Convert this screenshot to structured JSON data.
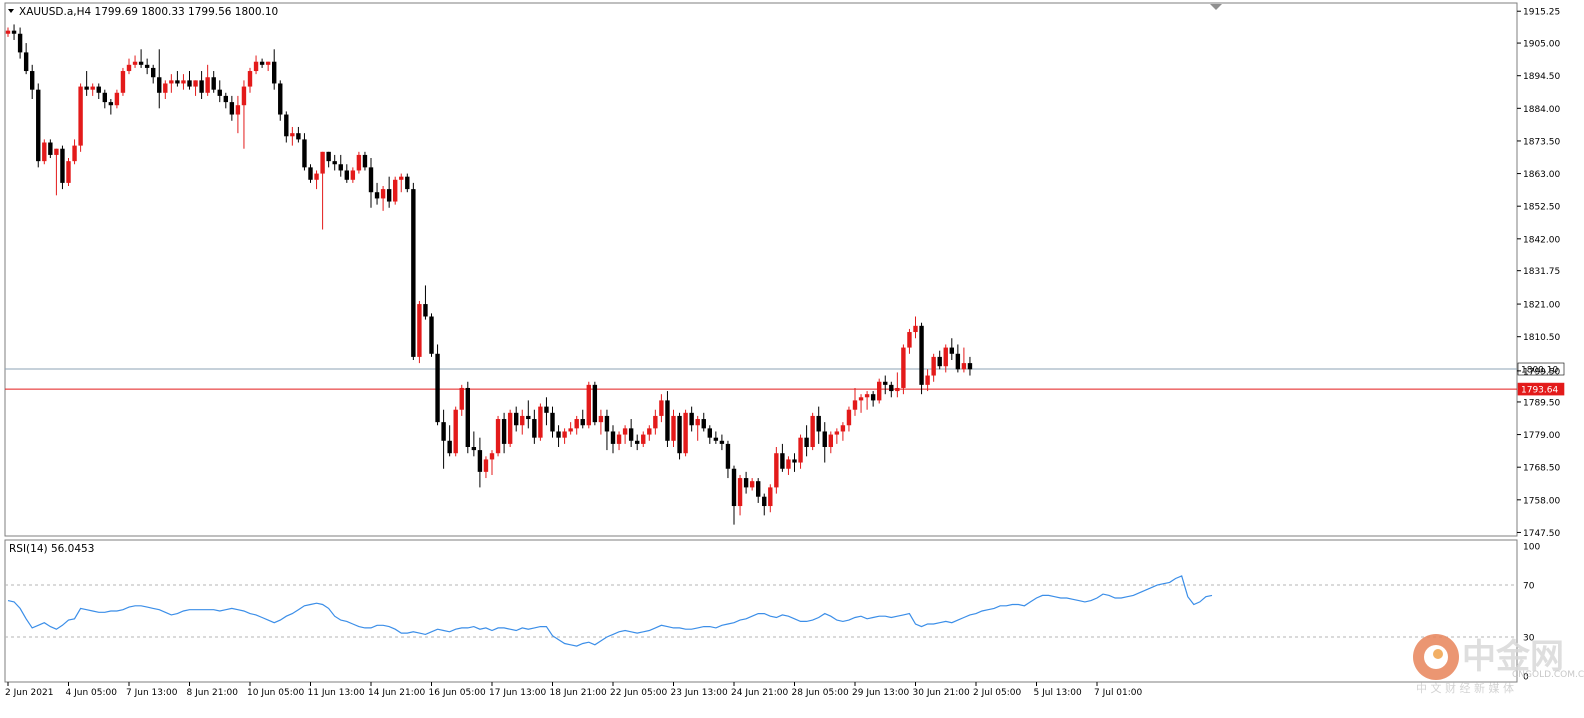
{
  "header": {
    "symbol_line": "XAUUSD.a,H4  1799.69 1800.33 1799.56 1800.10"
  },
  "rsi_panel": {
    "label": "RSI(14) 56.0453"
  },
  "watermark": {
    "brand": "中金网",
    "site": "CNGOLD.COM.CN",
    "tagline": "中 文 财 经 新 媒 体"
  },
  "chart_data": [
    {
      "type": "candlestick",
      "symbol": "XAUUSD.a",
      "timeframe": "H4",
      "ylim": [
        1747.0,
        1915.0
      ],
      "y_tick_labels": [
        "1915.25",
        "1905.00",
        "1894.50",
        "1884.00",
        "1873.50",
        "1863.00",
        "1852.50",
        "1842.00",
        "1831.75",
        "1821.00",
        "1810.50",
        "1799.50",
        "1789.50",
        "1779.00",
        "1768.50",
        "1758.00",
        "1747.50"
      ],
      "y_ticks": [
        1915.25,
        1905.0,
        1894.5,
        1884.0,
        1873.5,
        1863.0,
        1852.5,
        1842.0,
        1831.75,
        1821.0,
        1810.5,
        1799.5,
        1789.5,
        1779.0,
        1768.5,
        1758.0,
        1747.5
      ],
      "x_tick_labels": [
        "2 Jun 2021",
        "4 Jun 05:00",
        "7 Jun 13:00",
        "8 Jun 21:00",
        "10 Jun 05:00",
        "11 Jun 13:00",
        "14 Jun 21:00",
        "16 Jun 05:00",
        "17 Jun 13:00",
        "18 Jun 21:00",
        "22 Jun 05:00",
        "23 Jun 13:00",
        "24 Jun 21:00",
        "28 Jun 05:00",
        "29 Jun 13:00",
        "30 Jun 21:00",
        "2 Jul 05:00",
        "5 Jul 13:00",
        "7 Jul 01:00"
      ],
      "x_tick_index": [
        0,
        10,
        20,
        30,
        40,
        50,
        60,
        70,
        80,
        90,
        100,
        110,
        120,
        130,
        140,
        150,
        160,
        170,
        180
      ],
      "price_lines": [
        {
          "value": 1800.1,
          "label": "1800.10",
          "color": "#8ca3b5"
        },
        {
          "value": 1793.64,
          "label": "1793.64",
          "color": "#e31a1a"
        }
      ],
      "bull_color": "#e31a1a",
      "bear_color": "#000000",
      "ohlc": [
        [
          1908,
          1910,
          1907,
          1909
        ],
        [
          1909,
          1911,
          1906,
          1908
        ],
        [
          1908,
          1910,
          1900,
          1902
        ],
        [
          1902,
          1905,
          1895,
          1896
        ],
        [
          1896,
          1898,
          1887,
          1890
        ],
        [
          1890,
          1892,
          1865,
          1867
        ],
        [
          1867,
          1874,
          1866,
          1873
        ],
        [
          1873,
          1874,
          1868,
          1869
        ],
        [
          1869,
          1871,
          1856,
          1871
        ],
        [
          1871,
          1872,
          1858,
          1860
        ],
        [
          1860,
          1868,
          1859,
          1867
        ],
        [
          1867,
          1874,
          1866,
          1872
        ],
        [
          1872,
          1892,
          1870,
          1891
        ],
        [
          1891,
          1896,
          1888,
          1890
        ],
        [
          1890,
          1892,
          1888,
          1891
        ],
        [
          1891,
          1892,
          1887,
          1889
        ],
        [
          1889,
          1890,
          1884,
          1886
        ],
        [
          1886,
          1887,
          1882,
          1885
        ],
        [
          1885,
          1890,
          1884,
          1889
        ],
        [
          1889,
          1897,
          1888,
          1896
        ],
        [
          1896,
          1900,
          1895,
          1898
        ],
        [
          1898,
          1901,
          1897,
          1899
        ],
        [
          1899,
          1903,
          1897,
          1898
        ],
        [
          1898,
          1900,
          1895,
          1897
        ],
        [
          1897,
          1898,
          1892,
          1894
        ],
        [
          1894,
          1903,
          1884,
          1889
        ],
        [
          1889,
          1893,
          1887,
          1892
        ],
        [
          1892,
          1895,
          1889,
          1893
        ],
        [
          1893,
          1896,
          1891,
          1892
        ],
        [
          1892,
          1895,
          1890,
          1893
        ],
        [
          1893,
          1896,
          1890,
          1891
        ],
        [
          1891,
          1893,
          1888,
          1893
        ],
        [
          1893,
          1896,
          1887,
          1889
        ],
        [
          1889,
          1898,
          1888,
          1894
        ],
        [
          1894,
          1896,
          1889,
          1890
        ],
        [
          1890,
          1893,
          1886,
          1888
        ],
        [
          1888,
          1889,
          1884,
          1886
        ],
        [
          1886,
          1888,
          1880,
          1882
        ],
        [
          1882,
          1888,
          1876,
          1885
        ],
        [
          1885,
          1893,
          1871,
          1891
        ],
        [
          1891,
          1897,
          1889,
          1896
        ],
        [
          1896,
          1901,
          1895,
          1899
        ],
        [
          1899,
          1900,
          1897,
          1898
        ],
        [
          1898,
          1899,
          1896,
          1899
        ],
        [
          1899,
          1903,
          1890,
          1892
        ],
        [
          1892,
          1893,
          1880,
          1882
        ],
        [
          1882,
          1883,
          1873,
          1875
        ],
        [
          1875,
          1878,
          1872,
          1876
        ],
        [
          1876,
          1878,
          1873,
          1874
        ],
        [
          1874,
          1876,
          1864,
          1865
        ],
        [
          1865,
          1866,
          1860,
          1861
        ],
        [
          1861,
          1864,
          1858,
          1863
        ],
        [
          1863,
          1870,
          1845,
          1870
        ],
        [
          1870,
          1870,
          1865,
          1867
        ],
        [
          1867,
          1869,
          1864,
          1866
        ],
        [
          1866,
          1869,
          1862,
          1864
        ],
        [
          1864,
          1866,
          1860,
          1861
        ],
        [
          1861,
          1865,
          1860,
          1864
        ],
        [
          1864,
          1870,
          1863,
          1869
        ],
        [
          1869,
          1870,
          1864,
          1865
        ],
        [
          1865,
          1868,
          1852,
          1857
        ],
        [
          1857,
          1860,
          1853,
          1855
        ],
        [
          1855,
          1859,
          1851,
          1858
        ],
        [
          1858,
          1862,
          1852,
          1854
        ],
        [
          1854,
          1862,
          1853,
          1861
        ],
        [
          1861,
          1863,
          1857,
          1862
        ],
        [
          1862,
          1863,
          1857,
          1858
        ],
        [
          1858,
          1860,
          1803,
          1804
        ],
        [
          1804,
          1822,
          1802,
          1821
        ],
        [
          1821,
          1827,
          1816,
          1817
        ],
        [
          1817,
          1818,
          1804,
          1805
        ],
        [
          1805,
          1808,
          1782,
          1783
        ],
        [
          1783,
          1787,
          1768,
          1777
        ],
        [
          1777,
          1782,
          1772,
          1773
        ],
        [
          1773,
          1788,
          1772,
          1787
        ],
        [
          1787,
          1795,
          1785,
          1794
        ],
        [
          1794,
          1796,
          1773,
          1775
        ],
        [
          1775,
          1780,
          1772,
          1774
        ],
        [
          1774,
          1778,
          1762,
          1767
        ],
        [
          1767,
          1772,
          1765,
          1771
        ],
        [
          1771,
          1774,
          1766,
          1773
        ],
        [
          1773,
          1785,
          1772,
          1784
        ],
        [
          1784,
          1786,
          1773,
          1776
        ],
        [
          1776,
          1787,
          1775,
          1786
        ],
        [
          1786,
          1788,
          1780,
          1782
        ],
        [
          1782,
          1787,
          1779,
          1785
        ],
        [
          1785,
          1790,
          1781,
          1784
        ],
        [
          1784,
          1787,
          1776,
          1778
        ],
        [
          1778,
          1789,
          1777,
          1788
        ],
        [
          1788,
          1791,
          1782,
          1786
        ],
        [
          1786,
          1788,
          1778,
          1780
        ],
        [
          1780,
          1782,
          1775,
          1778
        ],
        [
          1778,
          1781,
          1776,
          1780
        ],
        [
          1780,
          1783,
          1779,
          1781
        ],
        [
          1781,
          1785,
          1779,
          1784
        ],
        [
          1784,
          1787,
          1781,
          1782
        ],
        [
          1782,
          1796,
          1781,
          1795
        ],
        [
          1795,
          1796,
          1782,
          1783
        ],
        [
          1783,
          1787,
          1779,
          1785
        ],
        [
          1785,
          1787,
          1774,
          1780
        ],
        [
          1780,
          1782,
          1773,
          1776
        ],
        [
          1776,
          1780,
          1774,
          1779
        ],
        [
          1779,
          1782,
          1776,
          1781
        ],
        [
          1781,
          1784,
          1775,
          1777
        ],
        [
          1777,
          1779,
          1774,
          1776
        ],
        [
          1776,
          1780,
          1775,
          1779
        ],
        [
          1779,
          1782,
          1777,
          1781
        ],
        [
          1781,
          1787,
          1779,
          1785
        ],
        [
          1785,
          1792,
          1783,
          1790
        ],
        [
          1790,
          1793,
          1775,
          1777
        ],
        [
          1777,
          1787,
          1775,
          1785
        ],
        [
          1785,
          1786,
          1771,
          1773
        ],
        [
          1773,
          1787,
          1772,
          1786
        ],
        [
          1786,
          1788,
          1780,
          1782
        ],
        [
          1782,
          1785,
          1777,
          1784
        ],
        [
          1784,
          1786,
          1780,
          1781
        ],
        [
          1781,
          1782,
          1776,
          1778
        ],
        [
          1778,
          1780,
          1776,
          1777
        ],
        [
          1777,
          1779,
          1774,
          1776
        ],
        [
          1776,
          1777,
          1765,
          1768
        ],
        [
          1768,
          1769,
          1750,
          1756
        ],
        [
          1756,
          1766,
          1753,
          1765
        ],
        [
          1765,
          1767,
          1760,
          1762
        ],
        [
          1762,
          1765,
          1761,
          1764
        ],
        [
          1764,
          1765,
          1757,
          1759
        ],
        [
          1759,
          1760,
          1753,
          1756
        ],
        [
          1756,
          1763,
          1754,
          1762
        ],
        [
          1762,
          1775,
          1760,
          1773
        ],
        [
          1773,
          1776,
          1767,
          1768
        ],
        [
          1768,
          1772,
          1766,
          1771
        ],
        [
          1771,
          1773,
          1767,
          1770
        ],
        [
          1770,
          1779,
          1768,
          1778
        ],
        [
          1778,
          1782,
          1772,
          1775
        ],
        [
          1775,
          1786,
          1774,
          1785
        ],
        [
          1785,
          1788,
          1776,
          1780
        ],
        [
          1780,
          1783,
          1770,
          1775
        ],
        [
          1775,
          1780,
          1773,
          1779
        ],
        [
          1779,
          1781,
          1776,
          1780
        ],
        [
          1780,
          1783,
          1777,
          1782
        ],
        [
          1782,
          1788,
          1780,
          1787
        ],
        [
          1787,
          1794,
          1785,
          1790
        ],
        [
          1790,
          1792,
          1786,
          1791
        ],
        [
          1791,
          1793,
          1787,
          1792
        ],
        [
          1792,
          1793,
          1788,
          1790
        ],
        [
          1790,
          1797,
          1789,
          1796
        ],
        [
          1796,
          1798,
          1792,
          1795
        ],
        [
          1795,
          1796,
          1791,
          1793
        ],
        [
          1793,
          1799,
          1791,
          1794
        ],
        [
          1794,
          1808,
          1792,
          1807
        ],
        [
          1807,
          1813,
          1805,
          1812
        ],
        [
          1812,
          1817,
          1810,
          1814
        ],
        [
          1814,
          1815,
          1792,
          1795
        ],
        [
          1795,
          1800,
          1793,
          1798
        ],
        [
          1798,
          1805,
          1796,
          1804
        ],
        [
          1804,
          1806,
          1800,
          1801
        ],
        [
          1801,
          1808,
          1799,
          1807
        ],
        [
          1807,
          1810,
          1803,
          1805
        ],
        [
          1805,
          1808,
          1799,
          1800
        ],
        [
          1800,
          1807,
          1799,
          1802
        ],
        [
          1802,
          1804,
          1798,
          1800
        ]
      ]
    },
    {
      "type": "line",
      "name": "RSI(14)",
      "ylim": [
        0,
        100
      ],
      "y_tick_labels": [
        "100",
        "70",
        "30",
        "0"
      ],
      "y_ticks": [
        100,
        70,
        30,
        0
      ],
      "levels": [
        70,
        30
      ],
      "line_color": "#3b8ee8",
      "values": [
        58,
        57,
        52,
        44,
        37,
        39,
        41,
        38,
        36,
        39,
        43,
        44,
        52,
        51,
        50,
        49,
        49,
        50,
        50,
        51,
        53,
        54,
        54,
        53,
        52,
        51,
        49,
        47,
        48,
        50,
        51,
        51,
        51,
        51,
        51,
        50,
        51,
        52,
        51,
        50,
        48,
        47,
        45,
        43,
        41,
        43,
        46,
        48,
        51,
        54,
        55,
        56,
        55,
        52,
        46,
        43,
        42,
        40,
        38,
        37,
        37,
        39,
        39,
        38,
        36,
        33,
        33,
        34,
        33,
        32,
        34,
        36,
        35,
        34,
        36,
        37,
        37,
        38,
        36,
        37,
        35,
        37,
        37,
        36,
        35,
        37,
        36,
        37,
        38,
        38,
        31,
        28,
        25,
        24,
        23,
        25,
        26,
        24,
        27,
        30,
        32,
        34,
        35,
        34,
        33,
        34,
        35,
        37,
        39,
        38,
        37,
        37,
        36,
        36,
        37,
        38,
        38,
        37,
        39,
        40,
        41,
        43,
        44,
        46,
        48,
        48,
        46,
        45,
        47,
        46,
        44,
        42,
        42,
        43,
        45,
        48,
        46,
        43,
        42,
        43,
        45,
        46,
        44,
        45,
        46,
        46,
        45,
        46,
        47,
        48,
        40,
        38,
        40,
        40,
        41,
        42,
        41,
        43,
        45,
        47,
        48,
        50,
        51,
        52,
        54,
        54,
        55,
        55,
        54,
        57,
        60,
        62,
        62,
        61,
        60,
        60,
        59,
        58,
        57,
        58,
        60,
        63,
        62,
        60,
        60,
        61,
        62,
        64,
        66,
        68,
        70,
        71,
        72,
        75,
        77,
        61,
        55,
        57,
        61,
        62
      ]
    }
  ]
}
